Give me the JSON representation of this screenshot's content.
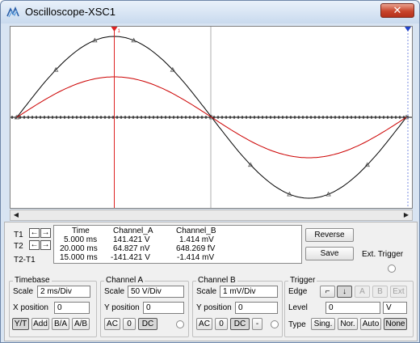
{
  "window": {
    "title": "Oscilloscope-XSC1",
    "close_label": "✕"
  },
  "colors": {
    "channel_a_trace": "#000000",
    "channel_b_trace": "#cc0000",
    "cursor_t1": "#dd2222",
    "cursor_t2": "#2244cc"
  },
  "readout": {
    "rows": [
      "T1",
      "T2",
      "T2-T1"
    ],
    "headers": {
      "time": "Time",
      "channel_a": "Channel_A",
      "channel_b": "Channel_B"
    },
    "t1": {
      "time": "5.000 ms",
      "a": "141.421 V",
      "b": "1.414 mV"
    },
    "t2": {
      "time": "20.000 ms",
      "a": "64.827 nV",
      "b": "648.269 fV"
    },
    "delta": {
      "time": "15.000 ms",
      "a": "-141.421 V",
      "b": "-1.414 mV"
    },
    "left_arrow": "←",
    "right_arrow": "→"
  },
  "buttons": {
    "reverse": "Reverse",
    "save": "Save",
    "ext_trigger": "Ext. Trigger"
  },
  "timebase": {
    "title": "Timebase",
    "scale_label": "Scale",
    "scale_value": "2 ms/Div",
    "xpos_label": "X position",
    "xpos_value": "0",
    "modes": [
      "Y/T",
      "Add",
      "B/A",
      "A/B"
    ]
  },
  "channel_a": {
    "title": "Channel A",
    "scale_label": "Scale",
    "scale_value": "50  V/Div",
    "ypos_label": "Y position",
    "ypos_value": "0",
    "coupling": [
      "AC",
      "0",
      "DC"
    ]
  },
  "channel_b": {
    "title": "Channel B",
    "scale_label": "Scale",
    "scale_value": "1 mV/Div",
    "ypos_label": "Y position",
    "ypos_value": "0",
    "coupling": [
      "AC",
      "0",
      "DC",
      "-"
    ]
  },
  "trigger": {
    "title": "Trigger",
    "edge_label": "Edge",
    "edge_buttons": [
      "⌐",
      "↓",
      "A",
      "B",
      "Ext"
    ],
    "level_label": "Level",
    "level_value": "0",
    "level_unit": "V",
    "type_label": "Type",
    "types": [
      "Sing.",
      "Nor.",
      "Auto",
      "None"
    ]
  },
  "chart_data": {
    "type": "line",
    "series": [
      {
        "name": "Channel_A",
        "shape": "sine",
        "amplitude": 1.0,
        "periods": 1
      },
      {
        "name": "Channel_B",
        "shape": "sine",
        "amplitude": 0.5,
        "periods": 1
      }
    ],
    "grid": "off",
    "cursors": [
      "T1",
      "T2"
    ]
  }
}
